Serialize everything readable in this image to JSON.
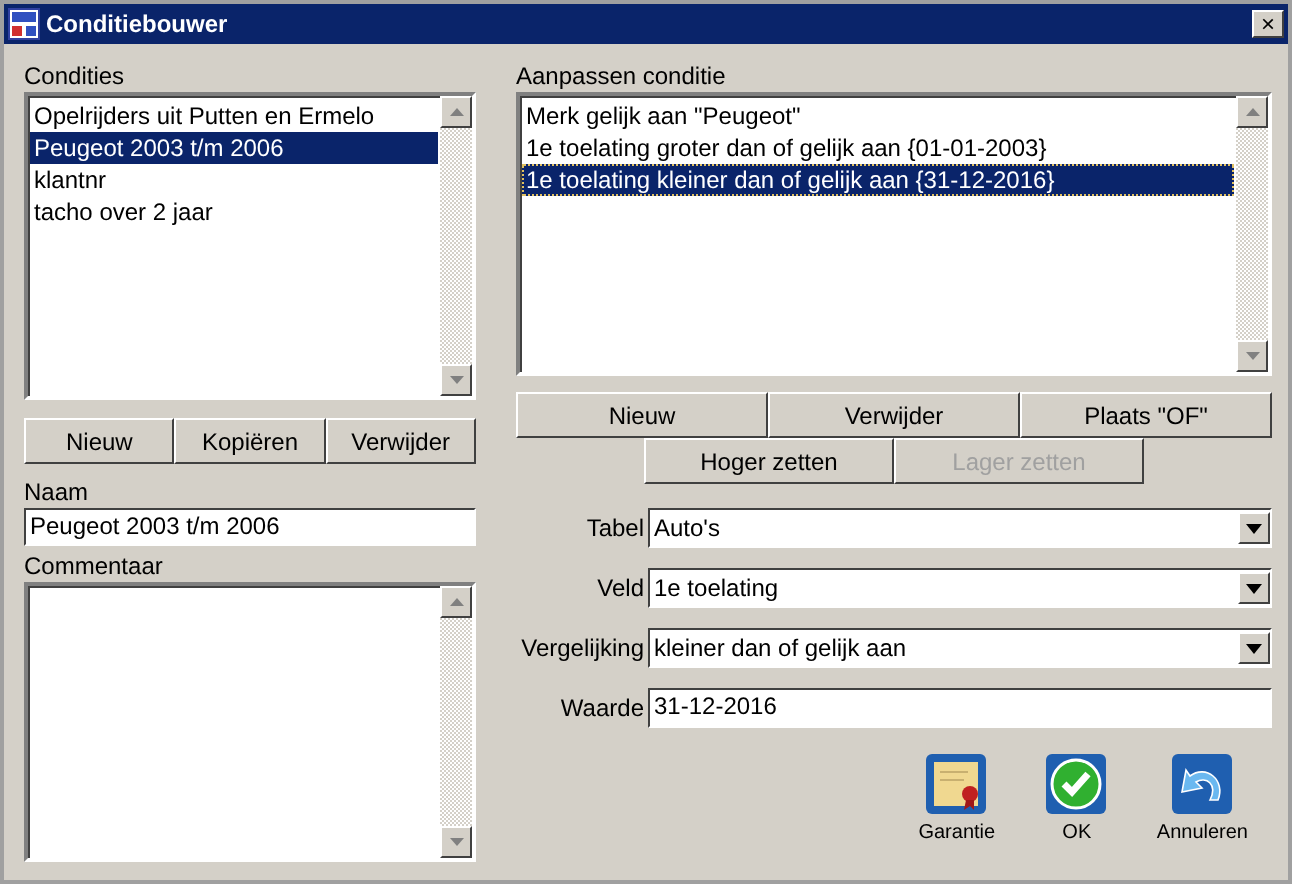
{
  "window": {
    "title": "Conditiebouwer",
    "close": "×"
  },
  "conditions": {
    "label": "Condities",
    "items": [
      {
        "text": "Opelrijders uit Putten en Ermelo",
        "selected": false
      },
      {
        "text": "Peugeot 2003 t/m 2006",
        "selected": true
      },
      {
        "text": "klantnr",
        "selected": false
      },
      {
        "text": "tacho over 2 jaar",
        "selected": false
      }
    ],
    "buttons": [
      "Nieuw",
      "Kopiëren",
      "Verwijder"
    ]
  },
  "name": {
    "label": "Naam",
    "value": "Peugeot 2003 t/m 2006"
  },
  "comment": {
    "label": "Commentaar"
  },
  "edit": {
    "label": "Aanpassen conditie",
    "items": [
      {
        "text": "Merk gelijk aan \"Peugeot\"",
        "selected": false
      },
      {
        "text": "1e toelating groter dan of gelijk aan {01-01-2003}",
        "selected": false
      },
      {
        "text": "1e toelating kleiner dan of gelijk aan {31-12-2016}",
        "selected": true
      }
    ],
    "buttons": [
      {
        "label": "Nieuw",
        "disabled": false
      },
      {
        "label": "Verwijder",
        "disabled": false
      },
      {
        "label": "Plaats \"OF\"",
        "disabled": false
      }
    ],
    "move_buttons": [
      {
        "label": "Hoger zetten",
        "disabled": false
      },
      {
        "label": "Lager zetten",
        "disabled": true
      }
    ]
  },
  "fields": [
    {
      "label": "Tabel",
      "value": "Auto's",
      "kind": "dropdown"
    },
    {
      "label": "Veld",
      "value": "1e toelating",
      "kind": "dropdown"
    },
    {
      "label": "Vergelijking",
      "value": "kleiner dan of gelijk aan",
      "kind": "dropdown"
    },
    {
      "label": "Waarde",
      "value": "31-12-2016",
      "kind": "text"
    }
  ],
  "actions": [
    {
      "label": "Garantie",
      "kind": "certificate"
    },
    {
      "label": "OK",
      "kind": "ok"
    },
    {
      "label": "Annuleren",
      "kind": "undo"
    }
  ]
}
